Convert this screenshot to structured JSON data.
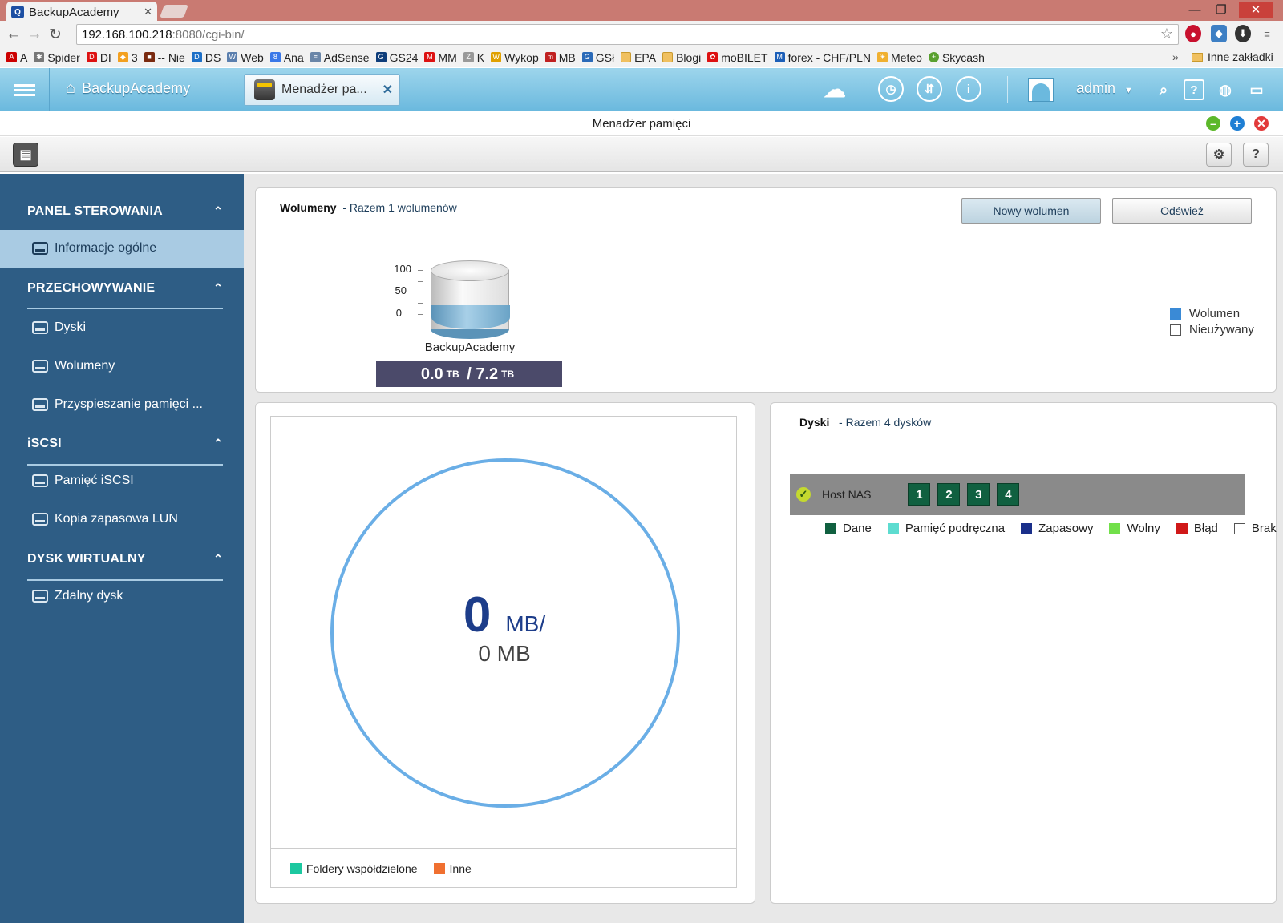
{
  "browser": {
    "tab_title": "BackupAcademy",
    "url_host": "192.168.100.218",
    "url_path": ":8080/cgi-bin/",
    "bookmarks": [
      "A",
      "Spider",
      "DI",
      "3",
      "-- Nie",
      "DS",
      "Web",
      "Ana",
      "AdSense",
      "GS24",
      "MM",
      "K",
      "Wykop",
      "MB",
      "GSł",
      "EPA",
      "Blogi",
      "moBILET",
      "forex - CHF/PLN",
      "Meteo",
      "Skycash"
    ],
    "bookmarks_more": "»",
    "bookmarks_other": "Inne zakładki"
  },
  "app": {
    "home_label": "BackupAcademy",
    "open_tab_label": "Menadżer pa...",
    "user": "admin",
    "window_title": "Menadżer pamięci"
  },
  "sidebar": {
    "sections": [
      {
        "title": "PANEL STEROWANIA",
        "items": [
          "Informacje ogólne"
        ]
      },
      {
        "title": "PRZECHOWYWANIE",
        "items": [
          "Dyski",
          "Wolumeny",
          "Przyspieszanie pamięci ..."
        ]
      },
      {
        "title": "iSCSI",
        "items": [
          "Pamięć iSCSI",
          "Kopia zapasowa LUN"
        ]
      },
      {
        "title": "DYSK WIRTUALNY",
        "items": [
          "Zdalny dysk"
        ]
      }
    ]
  },
  "volumes": {
    "title": "Wolumeny",
    "subtitle": "- Razem 1 wolumenów",
    "btn_new": "Nowy wolumen",
    "btn_refresh": "Odśwież",
    "axis_ticks": [
      "100",
      "50",
      "0"
    ],
    "volume_name": "BackupAcademy",
    "used": "0.0",
    "total": "7.2",
    "unit": "TB",
    "fill_fraction": 0.0,
    "legend": [
      "Wolumen",
      "Nieużywany"
    ]
  },
  "usage": {
    "value": "0",
    "unit_top": "MB/",
    "total": "0 MB",
    "legend": [
      "Foldery współdzielone",
      "Inne"
    ],
    "colors": {
      "ring": "#6aaee6",
      "shared": "#1cc8a0",
      "other": "#f07030"
    }
  },
  "disks": {
    "title": "Dyski",
    "subtitle": "- Razem 4 dysków",
    "host": "Host NAS",
    "disk_numbers": [
      "1",
      "2",
      "3",
      "4"
    ],
    "legend": [
      {
        "label": "Dane",
        "color": "#106040"
      },
      {
        "label": "Pamięć podręczna",
        "color": "#5ddcd0"
      },
      {
        "label": "Zapasowy",
        "color": "#1a2f8a"
      },
      {
        "label": "Wolny",
        "color": "#72e04a"
      },
      {
        "label": "Błąd",
        "color": "#d01818"
      },
      {
        "label": "Brak",
        "color": "#ffffff"
      }
    ]
  }
}
